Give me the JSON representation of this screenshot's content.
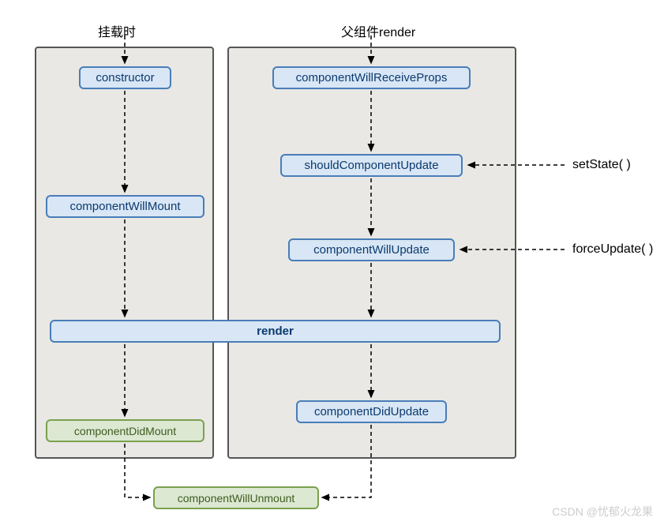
{
  "headings": {
    "left": "挂载时",
    "right": "父组件render"
  },
  "nodes": {
    "constructor": "constructor",
    "willmount": "componentWillMount",
    "didmount": "componentDidMount",
    "willreceive": "componentWillReceiveProps",
    "shouldupdate": "shouldComponentUpdate",
    "willupdate": "componentWillUpdate",
    "didupdate": "componentDidUpdate",
    "render": "render",
    "willunmount": "componentWillUnmount"
  },
  "sideLabels": {
    "setstate": "setState( )",
    "forceupdate": "forceUpdate( )"
  },
  "watermark": "CSDN @忧郁火龙果",
  "chart_data": {
    "type": "diagram",
    "title": "React Component Lifecycle (Legacy)",
    "columns": [
      {
        "name": "挂载时",
        "nodes": [
          "constructor",
          "componentWillMount",
          "render",
          "componentDidMount"
        ]
      },
      {
        "name": "父组件render",
        "nodes": [
          "componentWillReceiveProps",
          "shouldComponentUpdate",
          "componentWillUpdate",
          "render",
          "componentDidUpdate"
        ]
      }
    ],
    "edges": [
      {
        "from": "挂载时",
        "to": "constructor"
      },
      {
        "from": "constructor",
        "to": "componentWillMount"
      },
      {
        "from": "componentWillMount",
        "to": "render"
      },
      {
        "from": "render",
        "to": "componentDidMount"
      },
      {
        "from": "componentDidMount",
        "to": "componentWillUnmount"
      },
      {
        "from": "父组件render",
        "to": "componentWillReceiveProps"
      },
      {
        "from": "componentWillReceiveProps",
        "to": "shouldComponentUpdate"
      },
      {
        "from": "shouldComponentUpdate",
        "to": "componentWillUpdate"
      },
      {
        "from": "componentWillUpdate",
        "to": "render"
      },
      {
        "from": "render",
        "to": "componentDidUpdate"
      },
      {
        "from": "componentDidUpdate",
        "to": "componentWillUnmount"
      },
      {
        "from": "setState( )",
        "to": "shouldComponentUpdate"
      },
      {
        "from": "forceUpdate( )",
        "to": "componentWillUpdate"
      }
    ],
    "node_styles": {
      "blue": [
        "constructor",
        "componentWillMount",
        "componentWillReceiveProps",
        "shouldComponentUpdate",
        "componentWillUpdate",
        "render",
        "componentDidUpdate"
      ],
      "green": [
        "componentDidMount",
        "componentWillUnmount"
      ]
    }
  }
}
